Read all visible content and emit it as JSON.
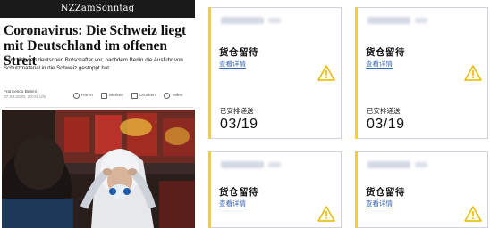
{
  "article": {
    "masthead": "NZZamSonntag",
    "headline": "Coronavirus: Die Schweiz liegt mit Deutschland im offenen Streit",
    "lead": "Bern lädt den deutschen Botschafter vor, nachdem Berlin die Ausfuhr von Schutzmaterial in die Schweiz gestoppt hat.",
    "author": "Francesco Benini",
    "date": "07.03.2020, 20:01 Uhr",
    "actions": [
      "Hören",
      "Merken",
      "Drucken",
      "Teilen"
    ]
  },
  "caption_fragment": "",
  "cards": [
    {
      "status": "货仓留待",
      "link": "查看详情",
      "sub": "已安排递送",
      "date": "03/19",
      "icon": "warning-icon"
    },
    {
      "status": "货仓留待",
      "link": "查看详情",
      "sub": "已安排递送",
      "date": "03/19",
      "icon": "warning-icon"
    },
    {
      "status": "货仓留待",
      "link": "查看详情",
      "icon": "warning-icon"
    },
    {
      "status": "货仓留待",
      "link": "查看详情",
      "icon": "warning-icon"
    }
  ],
  "colors": {
    "accent": "#f4d21f",
    "link": "#3b64b3",
    "border": "#cfd3dd"
  }
}
